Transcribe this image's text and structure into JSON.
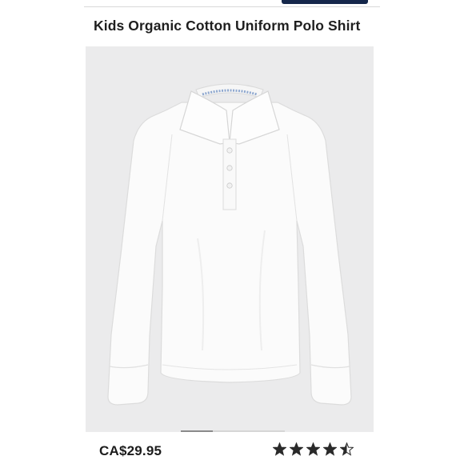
{
  "product": {
    "title": "Kids Organic Cotton Uniform Polo Shirt",
    "price": "CA$29.95",
    "image_icon": "white-long-sleeve-polo-shirt"
  },
  "rating": {
    "value": 4.5,
    "max": 5,
    "star_icon": "star-icon"
  },
  "carousel": {
    "current_slide_fraction": 0.31
  },
  "colors": {
    "brand_navy": "#15274b",
    "star": "#2a2a2a",
    "image_background": "#ebebec"
  }
}
